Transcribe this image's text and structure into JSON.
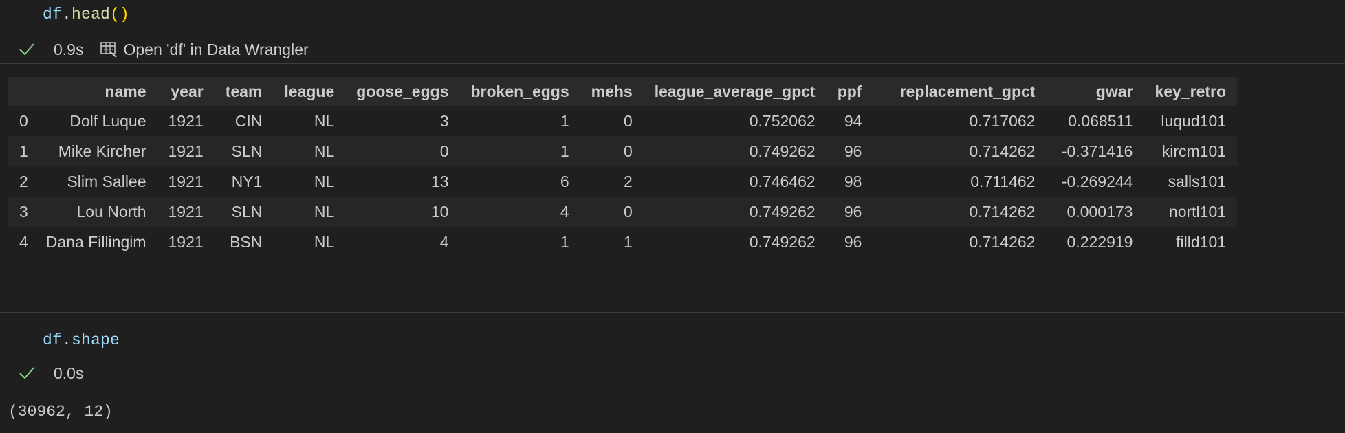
{
  "cell1": {
    "code": {
      "var": "df",
      "dot": ".",
      "fn": "head",
      "parens": "()"
    },
    "status": {
      "duration": "0.9s",
      "wrangler_label": "Open 'df' in Data Wrangler"
    },
    "table": {
      "columns": [
        "name",
        "year",
        "team",
        "league",
        "goose_eggs",
        "broken_eggs",
        "mehs",
        "league_average_gpct",
        "ppf",
        "replacement_gpct",
        "gwar",
        "key_retro"
      ],
      "rows": [
        {
          "index": "0",
          "cells": [
            "Dolf Luque",
            "1921",
            "CIN",
            "NL",
            "3",
            "1",
            "0",
            "0.752062",
            "94",
            "0.717062",
            "0.068511",
            "luqud101"
          ]
        },
        {
          "index": "1",
          "cells": [
            "Mike Kircher",
            "1921",
            "SLN",
            "NL",
            "0",
            "1",
            "0",
            "0.749262",
            "96",
            "0.714262",
            "-0.371416",
            "kircm101"
          ]
        },
        {
          "index": "2",
          "cells": [
            "Slim Sallee",
            "1921",
            "NY1",
            "NL",
            "13",
            "6",
            "2",
            "0.746462",
            "98",
            "0.711462",
            "-0.269244",
            "salls101"
          ]
        },
        {
          "index": "3",
          "cells": [
            "Lou North",
            "1921",
            "SLN",
            "NL",
            "10",
            "4",
            "0",
            "0.749262",
            "96",
            "0.714262",
            "0.000173",
            "nortl101"
          ]
        },
        {
          "index": "4",
          "cells": [
            "Dana Fillingim",
            "1921",
            "BSN",
            "NL",
            "4",
            "1",
            "1",
            "0.749262",
            "96",
            "0.714262",
            "0.222919",
            "filld101"
          ]
        }
      ]
    }
  },
  "cell2": {
    "code": {
      "var": "df",
      "dot": ".",
      "attr": "shape"
    },
    "status": {
      "duration": "0.0s"
    },
    "output": "(30962, 12)"
  },
  "colors": {
    "background": "#1f1f1f",
    "header_bg": "#2a2a2a",
    "check_green": "#89d185",
    "code_var": "#9cdcfe",
    "code_fn": "#dcdcaa",
    "code_paren": "#ffd700"
  },
  "icons": {
    "status_icon": "check-icon",
    "wrangler_icon": "data-wrangler-icon"
  }
}
